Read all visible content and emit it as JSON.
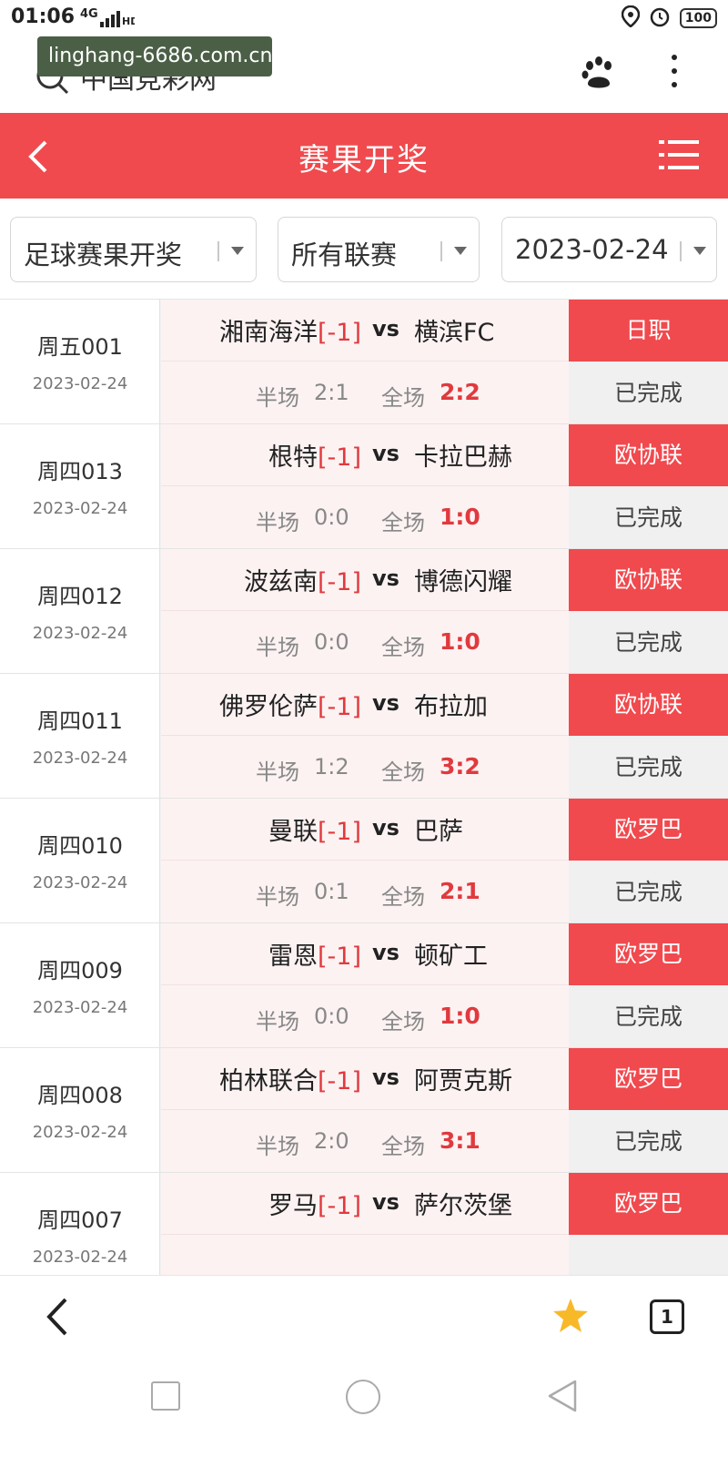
{
  "status_bar": {
    "time": "01:06",
    "network": "4G",
    "battery": "100"
  },
  "browser": {
    "site_title": "中国竞彩网",
    "url_tooltip": "linghang-6686.com.cn"
  },
  "header": {
    "title": "赛果开奖"
  },
  "filters": {
    "type": "足球赛果开奖",
    "league": "所有联赛",
    "date": "2023-02-24"
  },
  "labels": {
    "vs": "vs",
    "half": "半场",
    "full": "全场"
  },
  "matches": [
    {
      "no": "周五001",
      "date": "2023-02-24",
      "home": "湘南海洋",
      "handicap": "[-1]",
      "away": "横滨FC",
      "half": "2:1",
      "full": "2:2",
      "league": "日职",
      "status": "已完成"
    },
    {
      "no": "周四013",
      "date": "2023-02-24",
      "home": "根特",
      "handicap": "[-1]",
      "away": "卡拉巴赫",
      "half": "0:0",
      "full": "1:0",
      "league": "欧协联",
      "status": "已完成"
    },
    {
      "no": "周四012",
      "date": "2023-02-24",
      "home": "波兹南",
      "handicap": "[-1]",
      "away": "博德闪耀",
      "half": "0:0",
      "full": "1:0",
      "league": "欧协联",
      "status": "已完成"
    },
    {
      "no": "周四011",
      "date": "2023-02-24",
      "home": "佛罗伦萨",
      "handicap": "[-1]",
      "away": "布拉加",
      "half": "1:2",
      "full": "3:2",
      "league": "欧协联",
      "status": "已完成"
    },
    {
      "no": "周四010",
      "date": "2023-02-24",
      "home": "曼联",
      "handicap": "[-1]",
      "away": "巴萨",
      "half": "0:1",
      "full": "2:1",
      "league": "欧罗巴",
      "status": "已完成"
    },
    {
      "no": "周四009",
      "date": "2023-02-24",
      "home": "雷恩",
      "handicap": "[-1]",
      "away": "顿矿工",
      "half": "0:0",
      "full": "1:0",
      "league": "欧罗巴",
      "status": "已完成"
    },
    {
      "no": "周四008",
      "date": "2023-02-24",
      "home": "柏林联合",
      "handicap": "[-1]",
      "away": "阿贾克斯",
      "half": "2:0",
      "full": "3:1",
      "league": "欧罗巴",
      "status": "已完成"
    },
    {
      "no": "周四007",
      "date": "2023-02-24",
      "home": "罗马",
      "handicap": "[-1]",
      "away": "萨尔茨堡",
      "half": "",
      "full": "",
      "league": "欧罗巴",
      "status": ""
    }
  ],
  "bottom_bar": {
    "tab_count": "1"
  },
  "colors": {
    "brand_red": "#f04a4e",
    "score_red": "#e03a3e",
    "row_bg": "#fdf2f2"
  }
}
